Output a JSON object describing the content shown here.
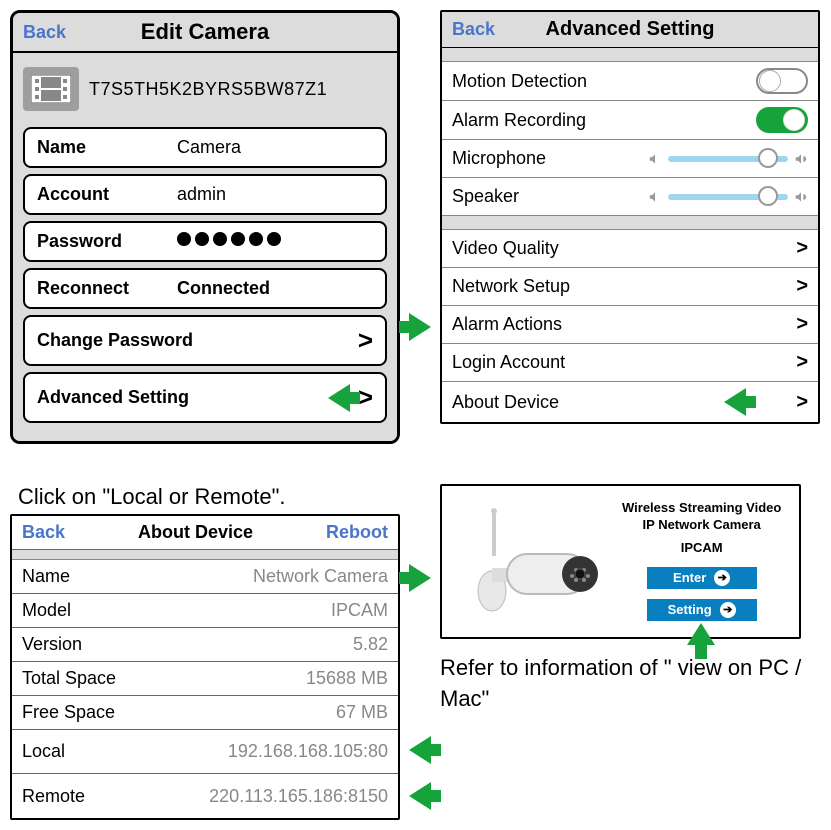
{
  "edit": {
    "back": "Back",
    "title": "Edit Camera",
    "deviceId": "T7S5TH5K2BYRS5BW87Z1",
    "fields": {
      "nameLabel": "Name",
      "nameValue": "Camera",
      "accountLabel": "Account",
      "accountValue": "admin",
      "passwordLabel": "Password",
      "reconnectLabel": "Reconnect",
      "reconnectValue": "Connected"
    },
    "nav": {
      "changePassword": "Change Password",
      "advancedSetting": "Advanced Setting"
    }
  },
  "advanced": {
    "back": "Back",
    "title": "Advanced Setting",
    "rows": {
      "motionDetection": "Motion Detection",
      "alarmRecording": "Alarm Recording",
      "microphone": "Microphone",
      "speaker": "Speaker",
      "videoQuality": "Video Quality",
      "networkSetup": "Network Setup",
      "alarmActions": "Alarm Actions",
      "loginAccount": "Login Account",
      "aboutDevice": "About Device"
    },
    "toggles": {
      "motionDetection": false,
      "alarmRecording": true
    }
  },
  "instruction1": "Click on \"Local or Remote\".",
  "about": {
    "back": "Back",
    "title": "About Device",
    "reboot": "Reboot",
    "rows": {
      "nameLabel": "Name",
      "nameValue": "Network Camera",
      "modelLabel": "Model",
      "modelValue": "IPCAM",
      "versionLabel": "Version",
      "versionValue": "5.82",
      "totalSpaceLabel": "Total Space",
      "totalSpaceValue": "15688 MB",
      "freeSpaceLabel": "Free Space",
      "freeSpaceValue": "67 MB",
      "localLabel": "Local",
      "localValue": "192.168.168.105:80",
      "remoteLabel": "Remote",
      "remoteValue": "220.113.165.186:8150"
    }
  },
  "cam": {
    "title": "Wireless Streaming Video\nIP Network Camera",
    "model": "IPCAM",
    "enterBtn": "Enter",
    "settingBtn": "Setting",
    "caption": "Refer to information of \" view on PC / Mac\""
  }
}
